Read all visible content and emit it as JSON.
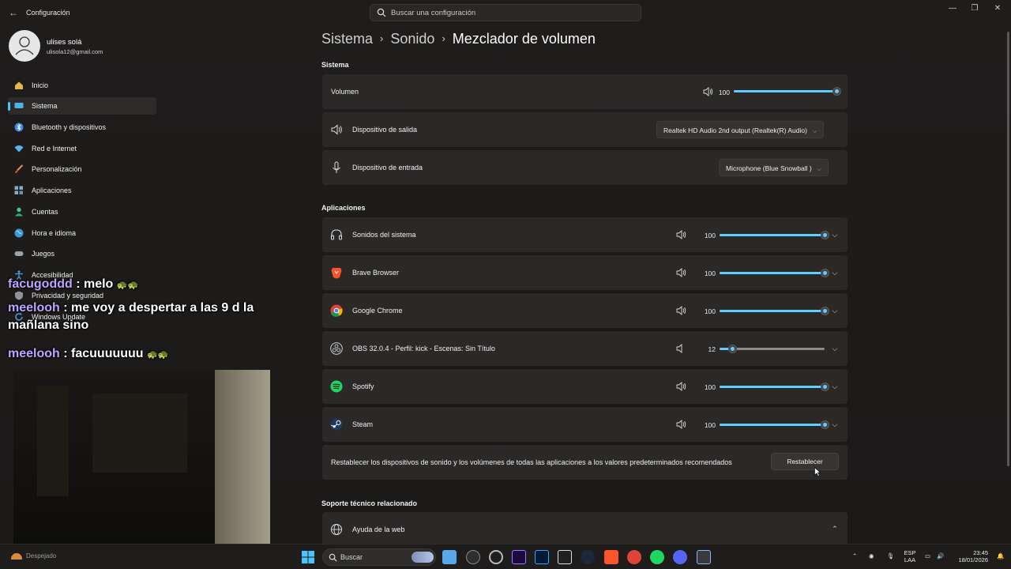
{
  "window": {
    "title": "Configuración",
    "search_placeholder": "Buscar una configuración"
  },
  "profile": {
    "name": "ulises solá",
    "email": "ulisola12@gmail.com"
  },
  "sidebar": {
    "items": [
      {
        "label": "Inicio",
        "icon": "home-icon"
      },
      {
        "label": "Sistema",
        "icon": "system-icon"
      },
      {
        "label": "Bluetooth y dispositivos",
        "icon": "bluetooth-icon"
      },
      {
        "label": "Red e Internet",
        "icon": "wifi-icon"
      },
      {
        "label": "Personalización",
        "icon": "brush-icon"
      },
      {
        "label": "Aplicaciones",
        "icon": "apps-icon"
      },
      {
        "label": "Cuentas",
        "icon": "accounts-icon"
      },
      {
        "label": "Hora e idioma",
        "icon": "globe-icon"
      },
      {
        "label": "Juegos",
        "icon": "gamepad-icon"
      },
      {
        "label": "Accesibilidad",
        "icon": "accessibility-icon"
      },
      {
        "label": "Privacidad y seguridad",
        "icon": "shield-icon"
      },
      {
        "label": "Windows Update",
        "icon": "update-icon"
      }
    ]
  },
  "breadcrumb": {
    "part1": "Sistema",
    "part2": "Sonido",
    "current": "Mezclador de volumen",
    "separator": "›"
  },
  "system_section": {
    "title": "Sistema",
    "volume_label": "Volumen",
    "volume_value": "100",
    "volume_level": 1.0,
    "output_label": "Dispositivo de salida",
    "output_value": "Realtek HD Audio 2nd output (Realtek(R) Audio)",
    "input_label": "Dispositivo de entrada",
    "input_value": "Microphone (Blue Snowball )"
  },
  "apps_section": {
    "title": "Aplicaciones",
    "apps": [
      {
        "name": "Sonidos del sistema",
        "volume": "100",
        "level": 1.0,
        "icon": "headphones-icon"
      },
      {
        "name": "Brave Browser",
        "volume": "100",
        "level": 1.0,
        "icon": "brave-icon"
      },
      {
        "name": "Google Chrome",
        "volume": "100",
        "level": 1.0,
        "icon": "chrome-icon"
      },
      {
        "name": "OBS 32.0.4 - Perfil: kick - Escenas: Sin Título",
        "volume": "12",
        "level": 0.12,
        "icon": "obs-icon"
      },
      {
        "name": "Spotify",
        "volume": "100",
        "level": 1.0,
        "icon": "spotify-icon"
      },
      {
        "name": "Steam",
        "volume": "100",
        "level": 1.0,
        "icon": "steam-icon"
      }
    ],
    "reset_text": "Restablecer los dispositivos de sonido y los volúmenes de todas las aplicaciones a los valores predeterminados recomendados",
    "reset_button": "Restablecer"
  },
  "support_section": {
    "title": "Soporte técnico relacionado",
    "help_label": "Ayuda de la web"
  },
  "chat": [
    {
      "user": "facugoddd",
      "text": " : melo"
    },
    {
      "user": "meelooh",
      "text": " : me voy a despertar a las 9 d la mañlana sino"
    },
    {
      "user": "meelooh",
      "text": " : facuuuuuuu"
    }
  ],
  "taskbar": {
    "weather": "Despejado",
    "search": "Buscar",
    "lang_top": "ESP",
    "lang_bottom": "LAA",
    "time": "23:45",
    "date": "18/01/2026"
  },
  "colors": {
    "accent": "#60cdff",
    "card": "#2b2928",
    "background": "#1c1a19"
  }
}
